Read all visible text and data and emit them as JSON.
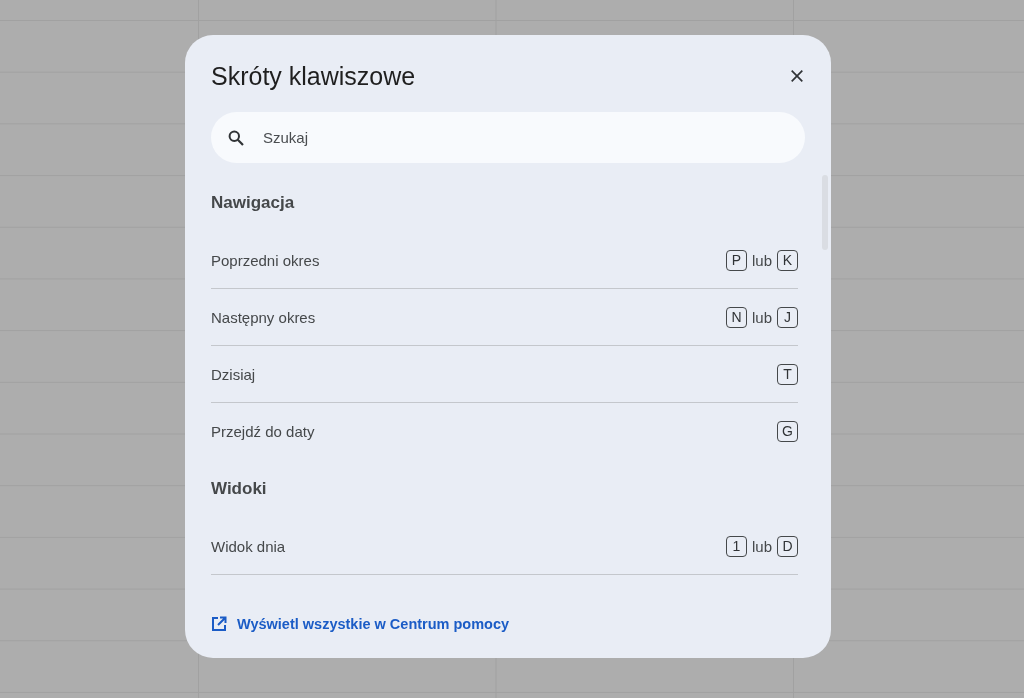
{
  "dialog": {
    "title": "Skróty klawiszowe",
    "search": {
      "placeholder": "Szukaj"
    },
    "sections": [
      {
        "title": "Nawigacja",
        "shortcuts": [
          {
            "label": "Poprzedni okres",
            "keys": [
              {
                "kind": "key",
                "text": "P"
              },
              {
                "kind": "text",
                "text": "lub"
              },
              {
                "kind": "key",
                "text": "K"
              }
            ],
            "divider": true
          },
          {
            "label": "Następny okres",
            "keys": [
              {
                "kind": "key",
                "text": "N"
              },
              {
                "kind": "text",
                "text": "lub"
              },
              {
                "kind": "key",
                "text": "J"
              }
            ],
            "divider": true
          },
          {
            "label": "Dzisiaj",
            "keys": [
              {
                "kind": "key",
                "text": "T"
              }
            ],
            "divider": true
          },
          {
            "label": "Przejdź do daty",
            "keys": [
              {
                "kind": "key",
                "text": "G"
              }
            ],
            "divider": false
          }
        ]
      },
      {
        "title": "Widoki",
        "shortcuts": [
          {
            "label": "Widok dnia",
            "keys": [
              {
                "kind": "key",
                "text": "1"
              },
              {
                "kind": "text",
                "text": "lub"
              },
              {
                "kind": "key",
                "text": "D"
              }
            ],
            "divider": true
          }
        ]
      }
    ],
    "footer_link": {
      "label": "Wyświetl wszystkie w Centrum pomocy"
    }
  }
}
